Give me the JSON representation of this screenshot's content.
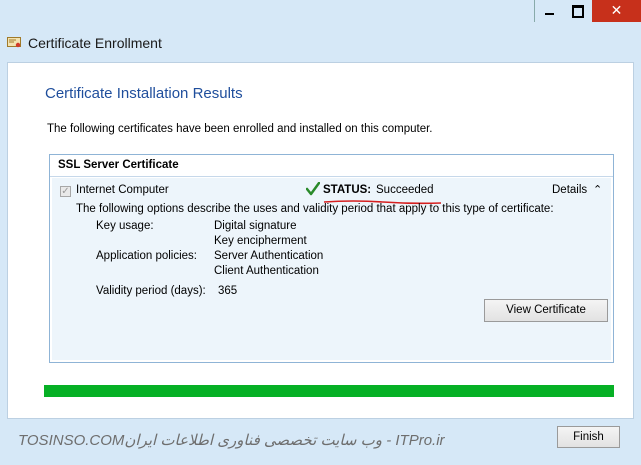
{
  "window": {
    "title": "Certificate Enrollment",
    "controls": {
      "minimize_icon": "minimize-icon",
      "maximize_icon": "maximize-icon",
      "close_icon": "close-icon"
    },
    "accent_close": "#c7301b"
  },
  "page": {
    "title": "Certificate Installation Results",
    "intro": "The following certificates have been enrolled and installed on this computer."
  },
  "certificate": {
    "section_title": "SSL Server Certificate",
    "name": "Internet Computer",
    "checked": true,
    "status_label": "STATUS:",
    "status_value": "Succeeded",
    "status_color": "#2a8a2a",
    "details_label": "Details",
    "description": "The following options describe the uses and validity period that apply to this type of certificate:",
    "properties": {
      "key_usage_label": "Key usage:",
      "key_usage_values": [
        "Digital signature",
        "Key encipherment"
      ],
      "app_policies_label": "Application policies:",
      "app_policies_values": [
        "Server Authentication",
        "Client Authentication"
      ],
      "validity_label": "Validity period (days):",
      "validity_value": "365"
    },
    "view_button": "View Certificate"
  },
  "progress": {
    "value": 1.0,
    "color": "#06b025"
  },
  "footer": {
    "watermark": "TOSINSO.COMوب سایت تخصصی فناوری اطلاعات ایران - ITPro.ir",
    "finish_button": "Finish"
  }
}
